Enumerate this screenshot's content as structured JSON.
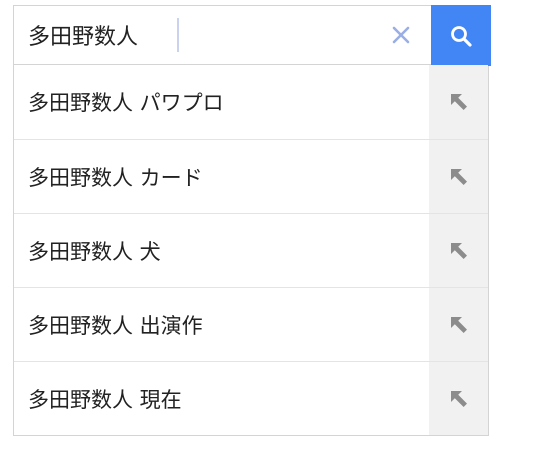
{
  "search": {
    "query": "多田野数人",
    "clear_icon": "close-icon",
    "submit_icon": "search-icon",
    "accent_color": "#4285f4"
  },
  "suggestions": [
    {
      "text": "多田野数人 パワプロ",
      "icon": "arrow-up-left-icon"
    },
    {
      "text": "多田野数人 カード",
      "icon": "arrow-up-left-icon"
    },
    {
      "text": "多田野数人 犬",
      "icon": "arrow-up-left-icon"
    },
    {
      "text": "多田野数人 出演作",
      "icon": "arrow-up-left-icon"
    },
    {
      "text": "多田野数人 現在",
      "icon": "arrow-up-left-icon"
    }
  ]
}
